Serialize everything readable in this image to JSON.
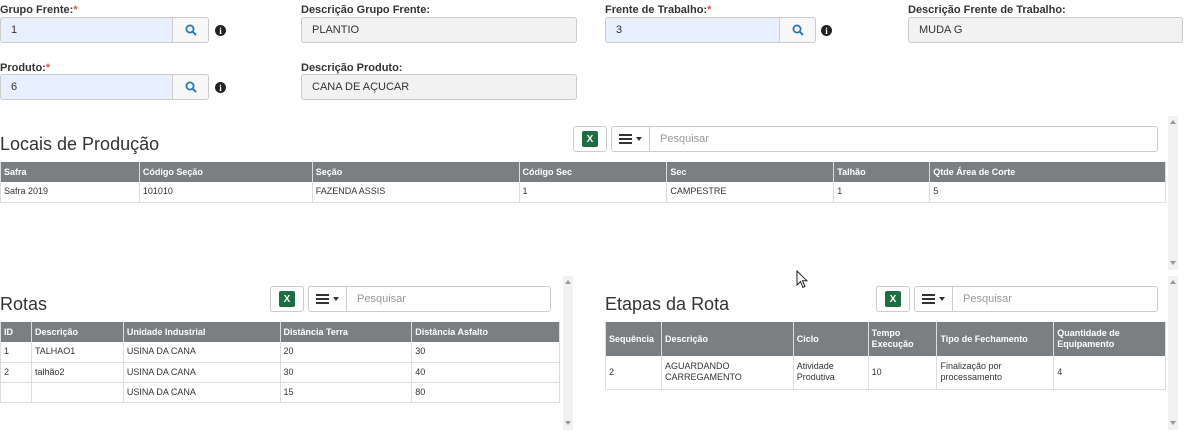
{
  "form": {
    "grupo_frente": {
      "label": "Grupo Frente:",
      "required": "*",
      "value": "1"
    },
    "desc_grupo_frente": {
      "label": "Descrição Grupo Frente:",
      "value": "PLANTIO"
    },
    "frente_trabalho": {
      "label": "Frente de Trabalho:",
      "required": "*",
      "value": "3"
    },
    "desc_frente_trabalho": {
      "label": "Descrição Frente de Trabalho:",
      "value": "MUDA G"
    },
    "produto": {
      "label": "Produto:",
      "required": "*",
      "value": "6"
    },
    "desc_produto": {
      "label": "Descrição Produto:",
      "value": "CANA DE AÇUCAR"
    },
    "info_glyph": "i"
  },
  "locais": {
    "title": "Locais de Produção",
    "search_placeholder": "Pesquisar",
    "columns": [
      "Safra",
      "Código Seção",
      "Seção",
      "Código Sec",
      "Sec",
      "Talhão",
      "Qtde Área de Corte"
    ],
    "rows": [
      [
        "Safra 2019",
        "101010",
        "FAZENDA ASSIS",
        "1",
        "CAMPESTRE",
        "1",
        "5"
      ]
    ]
  },
  "rotas": {
    "title": "Rotas",
    "search_placeholder": "Pesquisar",
    "columns": [
      "ID",
      "Descrição",
      "Unidade Industrial",
      "Distância Terra",
      "Distância Asfalto"
    ],
    "rows": [
      [
        "1",
        "TALHAO1",
        "USINA DA CANA",
        "20",
        "30"
      ],
      [
        "2",
        "talhão2",
        "USINA DA CANA",
        "30",
        "40"
      ],
      [
        "",
        "",
        "USINA DA CANA",
        "15",
        "80"
      ]
    ]
  },
  "etapas": {
    "title": "Etapas da Rota",
    "search_placeholder": "Pesquisar",
    "columns": [
      "Sequência",
      "Descrição",
      "Ciclo",
      "Tempo Execução",
      "Tipo de Fechamento",
      "Quantidade de Equipamento"
    ],
    "rows": [
      [
        "2",
        "AGUARDANDO CARREGAMENTO",
        "Atividade Produtiva",
        "10",
        "Finalização por processamento",
        "4"
      ]
    ]
  },
  "icons": {
    "excel": "excel-icon",
    "columns": "columns-menu-icon",
    "search": "search-icon",
    "info": "info-icon"
  },
  "colors": {
    "header_bg": "#7b7f82",
    "required": "#d9534f",
    "lookup_bg": "#e8f0fe",
    "excel": "#1d6f42"
  }
}
